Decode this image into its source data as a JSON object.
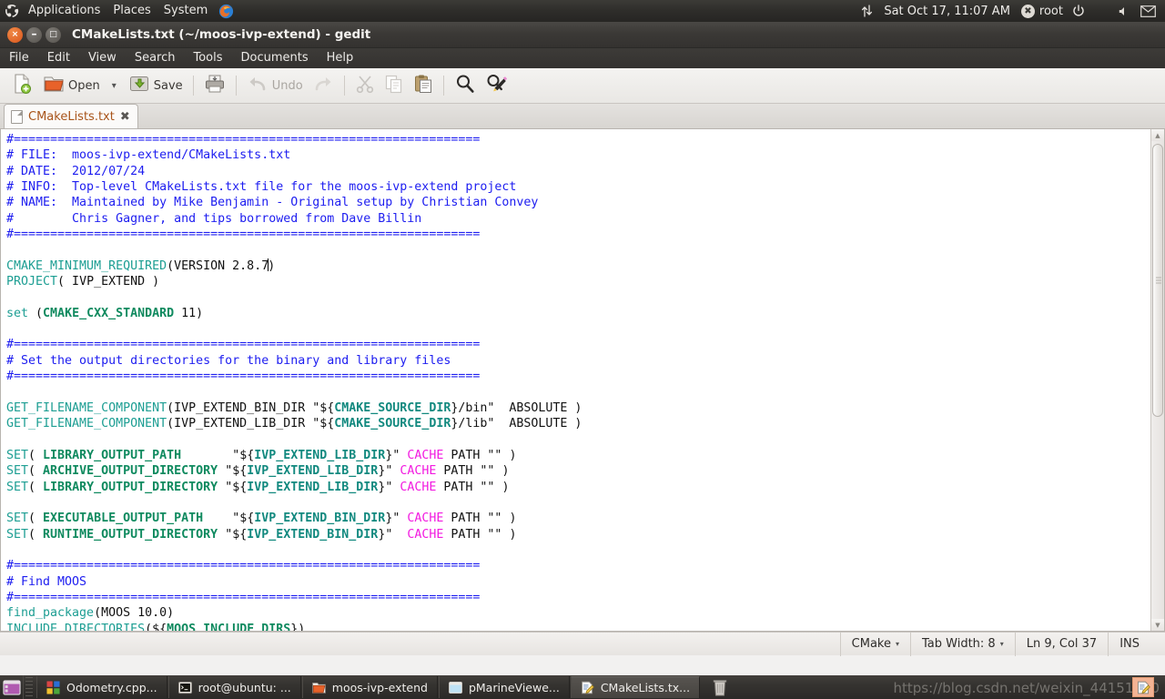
{
  "top_panel": {
    "logo": "ubuntu-logo",
    "menus": [
      "Applications",
      "Places",
      "System"
    ],
    "firefox_icon": "firefox-icon",
    "network_icon": "network-updown-icon",
    "clock": "Sat Oct 17, 11:07 AM",
    "user_icon": "user-avatar-icon",
    "user": "root",
    "power_icon": "power-icon",
    "volume_icon": "volume-icon",
    "mail_icon": "mail-icon"
  },
  "window": {
    "title": "CMakeLists.txt (~/moos-ivp-extend) - gedit",
    "buttons": {
      "close": "×",
      "minimize": "–",
      "maximize": "□"
    },
    "menubar": [
      "File",
      "Edit",
      "View",
      "Search",
      "Tools",
      "Documents",
      "Help"
    ],
    "toolbar": {
      "new_label": "",
      "open_label": "Open",
      "open_dropdown": "▾",
      "save_label": "Save",
      "print_label": "",
      "undo_label": "Undo",
      "redo_label": "",
      "cut_label": "",
      "copy_label": "",
      "paste_label": "",
      "find_label": "",
      "replace_label": ""
    },
    "tab": {
      "label": "CMakeLists.txt",
      "close": "✖"
    }
  },
  "statusbar": {
    "language": "CMake",
    "language_caret": "▾",
    "tab_width": "Tab Width: 8",
    "tab_caret": "▾",
    "position": "Ln 9, Col 37",
    "insert_mode": "INS"
  },
  "taskbar": {
    "show_desktop_icon": "show-desktop-icon",
    "items": [
      {
        "label": "Odometry.cpp...",
        "icon": "code-blocks-icon",
        "active": false
      },
      {
        "label": "root@ubuntu: ...",
        "icon": "terminal-icon",
        "active": false
      },
      {
        "label": "moos-ivp-extend",
        "icon": "folder-icon",
        "active": false
      },
      {
        "label": "pMarineViewe...",
        "icon": "window-icon",
        "active": false
      },
      {
        "label": "CMakeLists.tx...",
        "icon": "gedit-icon",
        "active": true
      }
    ],
    "trash_icon": "trash-icon",
    "tray_icon": "gedit-tray-icon",
    "watermark": "https://blog.csdn.net/weixin_44151170"
  },
  "editor": {
    "cursor_line": 9,
    "cursor_col": 37,
    "lines": [
      [
        {
          "t": "#================================================================",
          "c": "cmt"
        }
      ],
      [
        {
          "t": "# FILE:  moos-ivp-extend/CMakeLists.txt",
          "c": "cmt"
        }
      ],
      [
        {
          "t": "# DATE:  2012/07/24",
          "c": "cmt"
        }
      ],
      [
        {
          "t": "# INFO:  Top-level CMakeLists.txt file for the moos-ivp-extend project",
          "c": "cmt"
        }
      ],
      [
        {
          "t": "# NAME:  Maintained by Mike Benjamin - Original setup by Christian Convey",
          "c": "cmt"
        }
      ],
      [
        {
          "t": "#        Chris Gagner, and tips borrowed from Dave Billin",
          "c": "cmt"
        }
      ],
      [
        {
          "t": "#================================================================",
          "c": "cmt"
        }
      ],
      [
        {
          "t": "",
          "c": "plain"
        }
      ],
      [
        {
          "t": "CMAKE_MINIMUM_REQUIRED",
          "c": "cmd"
        },
        {
          "t": "(VERSION 2.8.7",
          "c": "plain"
        },
        {
          "t": "|",
          "c": "caret"
        },
        {
          "t": ")",
          "c": "plain"
        }
      ],
      [
        {
          "t": "PROJECT",
          "c": "cmd"
        },
        {
          "t": "( IVP_EXTEND )",
          "c": "plain"
        }
      ],
      [
        {
          "t": "",
          "c": "plain"
        }
      ],
      [
        {
          "t": "set ",
          "c": "cmd"
        },
        {
          "t": "(",
          "c": "plain"
        },
        {
          "t": "CMAKE_CXX_STANDARD",
          "c": "var"
        },
        {
          "t": " 11)",
          "c": "plain"
        }
      ],
      [
        {
          "t": "",
          "c": "plain"
        }
      ],
      [
        {
          "t": "#================================================================",
          "c": "cmt"
        }
      ],
      [
        {
          "t": "# Set the output directories for the binary and library files",
          "c": "cmt"
        }
      ],
      [
        {
          "t": "#================================================================",
          "c": "cmt"
        }
      ],
      [
        {
          "t": "",
          "c": "plain"
        }
      ],
      [
        {
          "t": "GET_FILENAME_COMPONENT",
          "c": "cmd"
        },
        {
          "t": "(IVP_EXTEND_BIN_DIR \"${",
          "c": "plain"
        },
        {
          "t": "CMAKE_SOURCE_DIR",
          "c": "var2"
        },
        {
          "t": "}/bin\"  ABSOLUTE )",
          "c": "plain"
        }
      ],
      [
        {
          "t": "GET_FILENAME_COMPONENT",
          "c": "cmd"
        },
        {
          "t": "(IVP_EXTEND_LIB_DIR \"${",
          "c": "plain"
        },
        {
          "t": "CMAKE_SOURCE_DIR",
          "c": "var2"
        },
        {
          "t": "}/lib\"  ABSOLUTE )",
          "c": "plain"
        }
      ],
      [
        {
          "t": "",
          "c": "plain"
        }
      ],
      [
        {
          "t": "SET",
          "c": "cmd"
        },
        {
          "t": "( ",
          "c": "plain"
        },
        {
          "t": "LIBRARY_OUTPUT_PATH",
          "c": "var"
        },
        {
          "t": "       \"${",
          "c": "plain"
        },
        {
          "t": "IVP_EXTEND_LIB_DIR",
          "c": "var2"
        },
        {
          "t": "}\" ",
          "c": "plain"
        },
        {
          "t": "CACHE",
          "c": "kw"
        },
        {
          "t": " PATH \"\" )",
          "c": "plain"
        }
      ],
      [
        {
          "t": "SET",
          "c": "cmd"
        },
        {
          "t": "( ",
          "c": "plain"
        },
        {
          "t": "ARCHIVE_OUTPUT_DIRECTORY",
          "c": "var"
        },
        {
          "t": " \"${",
          "c": "plain"
        },
        {
          "t": "IVP_EXTEND_LIB_DIR",
          "c": "var2"
        },
        {
          "t": "}\" ",
          "c": "plain"
        },
        {
          "t": "CACHE",
          "c": "kw"
        },
        {
          "t": " PATH \"\" )",
          "c": "plain"
        }
      ],
      [
        {
          "t": "SET",
          "c": "cmd"
        },
        {
          "t": "( ",
          "c": "plain"
        },
        {
          "t": "LIBRARY_OUTPUT_DIRECTORY",
          "c": "var"
        },
        {
          "t": " \"${",
          "c": "plain"
        },
        {
          "t": "IVP_EXTEND_LIB_DIR",
          "c": "var2"
        },
        {
          "t": "}\" ",
          "c": "plain"
        },
        {
          "t": "CACHE",
          "c": "kw"
        },
        {
          "t": " PATH \"\" )",
          "c": "plain"
        }
      ],
      [
        {
          "t": "",
          "c": "plain"
        }
      ],
      [
        {
          "t": "SET",
          "c": "cmd"
        },
        {
          "t": "( ",
          "c": "plain"
        },
        {
          "t": "EXECUTABLE_OUTPUT_PATH",
          "c": "var"
        },
        {
          "t": "    \"${",
          "c": "plain"
        },
        {
          "t": "IVP_EXTEND_BIN_DIR",
          "c": "var2"
        },
        {
          "t": "}\" ",
          "c": "plain"
        },
        {
          "t": "CACHE",
          "c": "kw"
        },
        {
          "t": " PATH \"\" )",
          "c": "plain"
        }
      ],
      [
        {
          "t": "SET",
          "c": "cmd"
        },
        {
          "t": "( ",
          "c": "plain"
        },
        {
          "t": "RUNTIME_OUTPUT_DIRECTORY",
          "c": "var"
        },
        {
          "t": " \"${",
          "c": "plain"
        },
        {
          "t": "IVP_EXTEND_BIN_DIR",
          "c": "var2"
        },
        {
          "t": "}\"  ",
          "c": "plain"
        },
        {
          "t": "CACHE",
          "c": "kw"
        },
        {
          "t": " PATH \"\" )",
          "c": "plain"
        }
      ],
      [
        {
          "t": "",
          "c": "plain"
        }
      ],
      [
        {
          "t": "#================================================================",
          "c": "cmt"
        }
      ],
      [
        {
          "t": "# Find MOOS",
          "c": "cmt"
        }
      ],
      [
        {
          "t": "#================================================================",
          "c": "cmt"
        }
      ],
      [
        {
          "t": "find_package",
          "c": "cmd"
        },
        {
          "t": "(MOOS 10.0)",
          "c": "plain"
        }
      ],
      [
        {
          "t": "INCLUDE_DIRECTORIES",
          "c": "cmd"
        },
        {
          "t": "(${",
          "c": "plain"
        },
        {
          "t": "MOOS_INCLUDE_DIRS",
          "c": "var"
        },
        {
          "t": "})",
          "c": "plain"
        }
      ],
      [
        {
          "t": "",
          "c": "plain"
        }
      ],
      [
        {
          "t": "",
          "c": "plain"
        }
      ],
      [
        {
          "t": "#================================================================",
          "c": "cmt"
        }
      ]
    ]
  },
  "colors": {
    "comment": "#1d1df0",
    "command": "#1d9e93",
    "variable": "#0f8a5f",
    "keyword": "#f21ae0",
    "accent": "#d9551b"
  }
}
